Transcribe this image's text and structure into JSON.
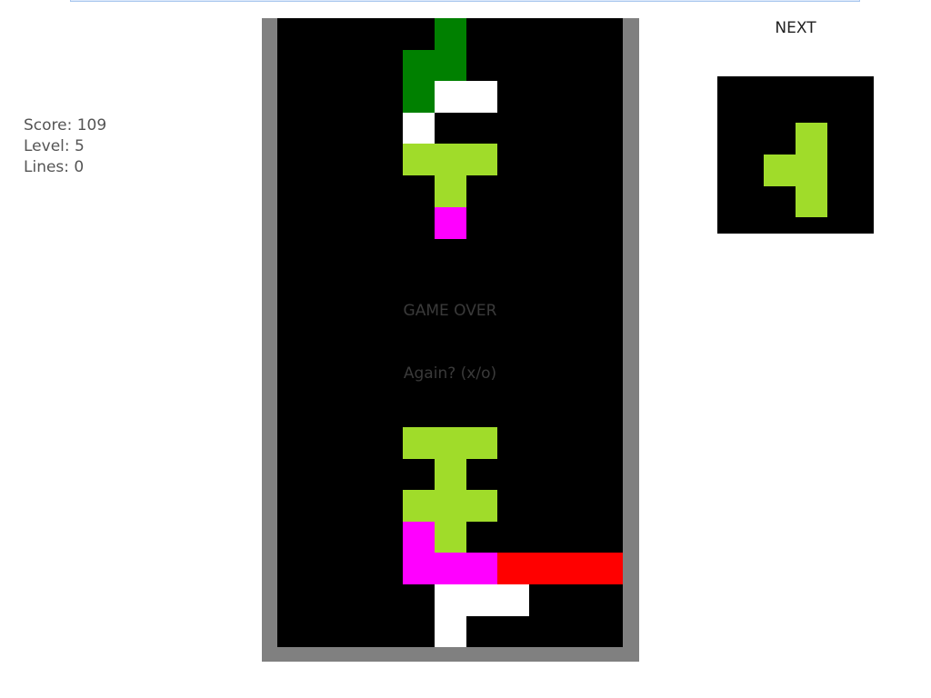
{
  "colors": {
    "frame": "#808080",
    "well": "#000000",
    "green": "#008000",
    "lime": "#a0dc2a",
    "white": "#ffffff",
    "magenta": "#ff00ff",
    "red": "#ff0000"
  },
  "stats": {
    "score_text": "Score: 109",
    "level_text": "Level: 5",
    "lines_text": "Lines: 0"
  },
  "overlay": {
    "game_over": "GAME OVER",
    "again_prompt": "Again? (x/o)"
  },
  "next": {
    "label": "NEXT",
    "piece_color": "lime"
  },
  "board": {
    "columns": 11,
    "visible_rows": 20,
    "filled_cells": [
      {
        "col": 5,
        "row": 0,
        "color": "green"
      },
      {
        "col": 4,
        "row": 1,
        "color": "green"
      },
      {
        "col": 5,
        "row": 1,
        "color": "green"
      },
      {
        "col": 4,
        "row": 2,
        "color": "green"
      },
      {
        "col": 5,
        "row": 2,
        "color": "white"
      },
      {
        "col": 6,
        "row": 2,
        "color": "white"
      },
      {
        "col": 4,
        "row": 3,
        "color": "white"
      },
      {
        "col": 4,
        "row": 4,
        "color": "lime"
      },
      {
        "col": 5,
        "row": 4,
        "color": "lime"
      },
      {
        "col": 6,
        "row": 4,
        "color": "lime"
      },
      {
        "col": 5,
        "row": 5,
        "color": "lime"
      },
      {
        "col": 5,
        "row": 6,
        "color": "magenta"
      },
      {
        "col": 4,
        "row": 13,
        "color": "lime"
      },
      {
        "col": 5,
        "row": 13,
        "color": "lime"
      },
      {
        "col": 6,
        "row": 13,
        "color": "lime"
      },
      {
        "col": 5,
        "row": 14,
        "color": "lime"
      },
      {
        "col": 4,
        "row": 15,
        "color": "lime"
      },
      {
        "col": 5,
        "row": 15,
        "color": "lime"
      },
      {
        "col": 6,
        "row": 15,
        "color": "lime"
      },
      {
        "col": 4,
        "row": 16,
        "color": "magenta"
      },
      {
        "col": 5,
        "row": 16,
        "color": "lime"
      },
      {
        "col": 4,
        "row": 17,
        "color": "magenta"
      },
      {
        "col": 5,
        "row": 17,
        "color": "magenta"
      },
      {
        "col": 6,
        "row": 17,
        "color": "magenta"
      },
      {
        "col": 7,
        "row": 17,
        "color": "red"
      },
      {
        "col": 8,
        "row": 17,
        "color": "red"
      },
      {
        "col": 9,
        "row": 17,
        "color": "red"
      },
      {
        "col": 10,
        "row": 17,
        "color": "red"
      },
      {
        "col": 5,
        "row": 18,
        "color": "white"
      },
      {
        "col": 6,
        "row": 18,
        "color": "white"
      },
      {
        "col": 7,
        "row": 18,
        "color": "white"
      },
      {
        "col": 5,
        "row": 19,
        "color": "white"
      }
    ]
  },
  "next_piece": {
    "cells": [
      {
        "col": 1,
        "row": 0
      },
      {
        "col": 0,
        "row": 1
      },
      {
        "col": 1,
        "row": 1
      },
      {
        "col": 1,
        "row": 2
      }
    ]
  }
}
